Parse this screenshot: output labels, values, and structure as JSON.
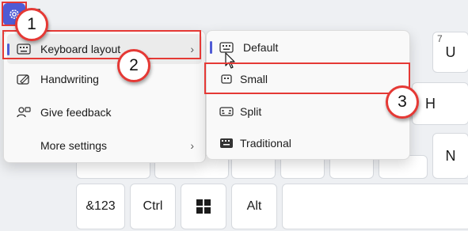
{
  "keyboard": {
    "keys_top": [
      {
        "hint": "7",
        "main": "U"
      }
    ],
    "key_h": "H",
    "key_n": "N",
    "bottom": {
      "num_label": "&123",
      "ctrl_label": "Ctrl",
      "alt_label": "Alt"
    }
  },
  "menu": {
    "items": [
      {
        "label": "Keyboard layout",
        "icon": "keyboard-icon"
      },
      {
        "label": "Handwriting",
        "icon": "handwriting-icon"
      },
      {
        "label": "Give feedback",
        "icon": "feedback-icon"
      },
      {
        "label": "More settings",
        "icon": ""
      }
    ]
  },
  "submenu": {
    "items": [
      {
        "label": "Default",
        "icon": "keyboard-default-icon"
      },
      {
        "label": "Small",
        "icon": "keyboard-small-icon"
      },
      {
        "label": "Split",
        "icon": "keyboard-split-icon"
      },
      {
        "label": "Traditional",
        "icon": "keyboard-traditional-icon"
      }
    ]
  },
  "badges": [
    "1",
    "2",
    "3"
  ],
  "colors": {
    "accent": "#4f5bd5",
    "annotation": "#e53935",
    "settings_button_bg": "#4f5bd5"
  }
}
